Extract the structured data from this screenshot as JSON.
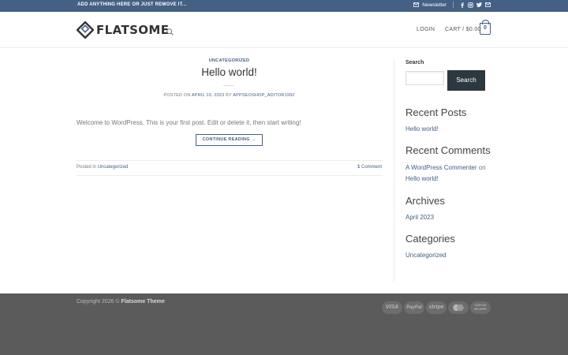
{
  "topbar": {
    "message": "ADD ANYTHING HERE OR JUST REMOVE IT...",
    "newsletter_label": "Newsletter",
    "social_icons": [
      "facebook-icon",
      "instagram-icon",
      "twitter-icon",
      "mail-icon"
    ]
  },
  "header": {
    "logo_text": "FLATSOME",
    "login_label": "LOGIN",
    "cart_label": "CART / $0.00",
    "cart_count": "0"
  },
  "post": {
    "category": "UNCATEGORIZED",
    "title": "Hello world!",
    "meta_prefix": "POSTED ON",
    "meta_date": "APRIL 10, 2023",
    "meta_by": "BY",
    "meta_author": "APPSEOSHOP_ADITOR1992",
    "excerpt": "Welcome to WordPress. This is your first post. Edit or delete it, then start writing!",
    "read_more": "CONTINUE READING →",
    "posted_in_prefix": "Posted in",
    "posted_in_category": "Uncategorized",
    "comments_count": "1",
    "comments_label": "Comment"
  },
  "sidebar": {
    "search_label": "Search",
    "search_button": "Search",
    "recent_posts_title": "Recent Posts",
    "recent_post_1": "Hello world!",
    "recent_comments_title": "Recent Comments",
    "comment_author": "A WordPress Commenter",
    "comment_on": "on",
    "comment_post": "Hello world!",
    "archives_title": "Archives",
    "archive_1": "April 2023",
    "categories_title": "Categories",
    "category_1": "Uncategorized"
  },
  "footer": {
    "copyright_prefix": "Copyright 2026 ©",
    "copyright_brand": "Flatsome Theme",
    "payment_icons": [
      "VISA",
      "PayPal",
      "stripe",
      "mastercard",
      "CASH ON DELIVERY"
    ]
  },
  "colors": {
    "primary": "#446084",
    "footer_bg": "#5b5b5b",
    "button_dark": "#2c3840"
  }
}
